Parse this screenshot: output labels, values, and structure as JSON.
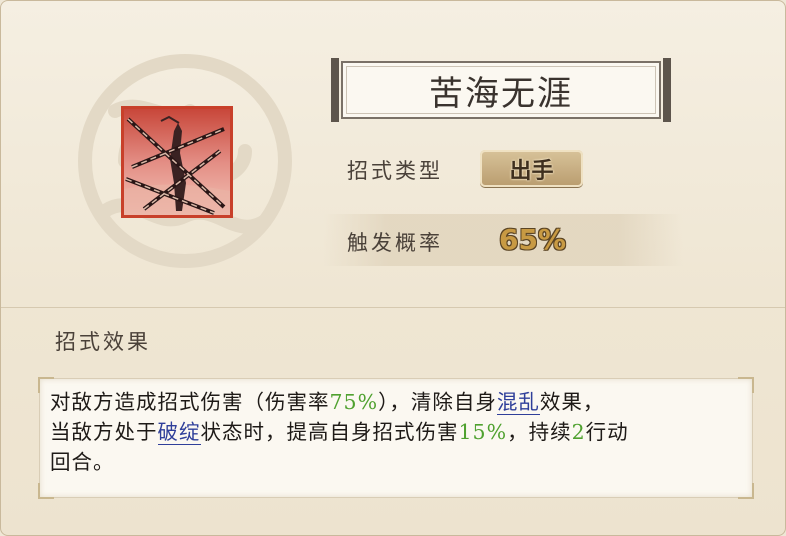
{
  "skill": {
    "name": "苦海无涯",
    "icon": "chained-warrior-icon"
  },
  "type_row": {
    "label": "招式类型",
    "value": "出手"
  },
  "probability_row": {
    "label": "触发概率",
    "value": "65%"
  },
  "effect": {
    "heading": "招式效果",
    "line1": {
      "t1": "对敌方造成招式伤害（伤害率",
      "v1": "75%",
      "t2": "），清除自身",
      "kw1": "混乱",
      "t3": "效果，"
    },
    "line2": {
      "t1": "当敌方处于",
      "kw2": "破绽",
      "t2": "状态时，提高自身招式伤害",
      "v2": "15%",
      "t3": "，持续",
      "v3": "2",
      "t4": "行动"
    },
    "line3": "回合。"
  },
  "colors": {
    "highlight_value": "#4fa12f",
    "keyword_link": "#2f3f9a",
    "probability_gold": "#c89a43",
    "icon_border": "#c8402a"
  }
}
